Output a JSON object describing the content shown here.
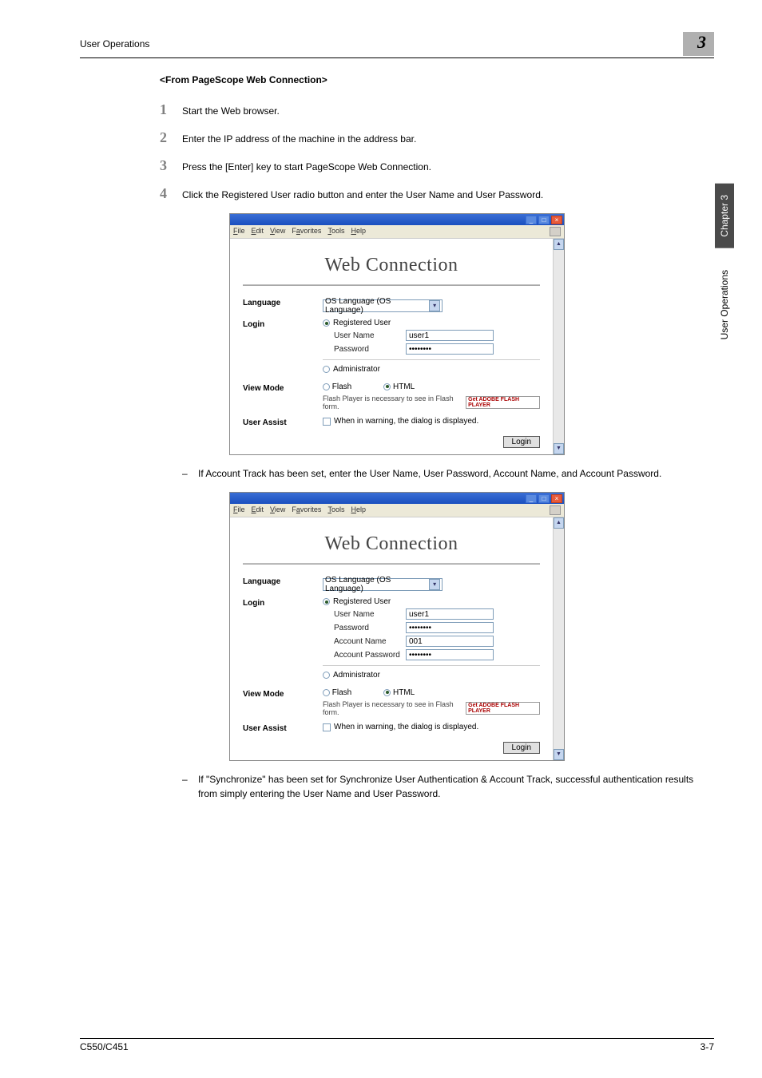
{
  "header": {
    "section": "User Operations",
    "chapter_num": "3"
  },
  "section_title": "<From PageScope Web Connection>",
  "steps": [
    {
      "num": "1",
      "text": "Start the Web browser."
    },
    {
      "num": "2",
      "text": "Enter the IP address of the machine in the address bar."
    },
    {
      "num": "3",
      "text": "Press the [Enter] key to start PageScope Web Connection."
    },
    {
      "num": "4",
      "text": "Click the Registered User radio button and enter the User Name and User Password."
    }
  ],
  "sub_items": [
    "If Account Track has been set, enter the User Name, User Password, Account Name, and Account Password.",
    "If \"Synchronize\" has been set for Synchronize User Authentication & Account Track, successful authentication results from simply entering the User Name and User Password."
  ],
  "browser": {
    "menu": {
      "file": "File",
      "edit": "Edit",
      "view": "View",
      "favorites": "Favorites",
      "tools": "Tools",
      "help": "Help"
    }
  },
  "webconn": {
    "brand": "Web Connection",
    "labels": {
      "language": "Language",
      "login": "Login",
      "view_mode": "View Mode",
      "user_assist": "User Assist"
    },
    "language_value": "OS Language (OS Language)",
    "registered_user": "Registered User",
    "administrator": "Administrator",
    "user_name_label": "User Name",
    "password_label": "Password",
    "account_name_label": "Account Name",
    "account_password_label": "Account Password",
    "user_name_value": "user1",
    "password_value": "••••••••",
    "account_name_value": "001",
    "account_password_value": "••••••••",
    "flash": "Flash",
    "html": "HTML",
    "flash_note": "Flash Player is necessary to see in Flash form.",
    "flash_badge": "Get ADOBE FLASH PLAYER",
    "user_assist_text": "When in warning, the dialog is displayed.",
    "login_btn": "Login"
  },
  "side": {
    "chapter": "Chapter 3",
    "uo": "User Operations"
  },
  "footer": {
    "left": "C550/C451",
    "right": "3-7"
  }
}
